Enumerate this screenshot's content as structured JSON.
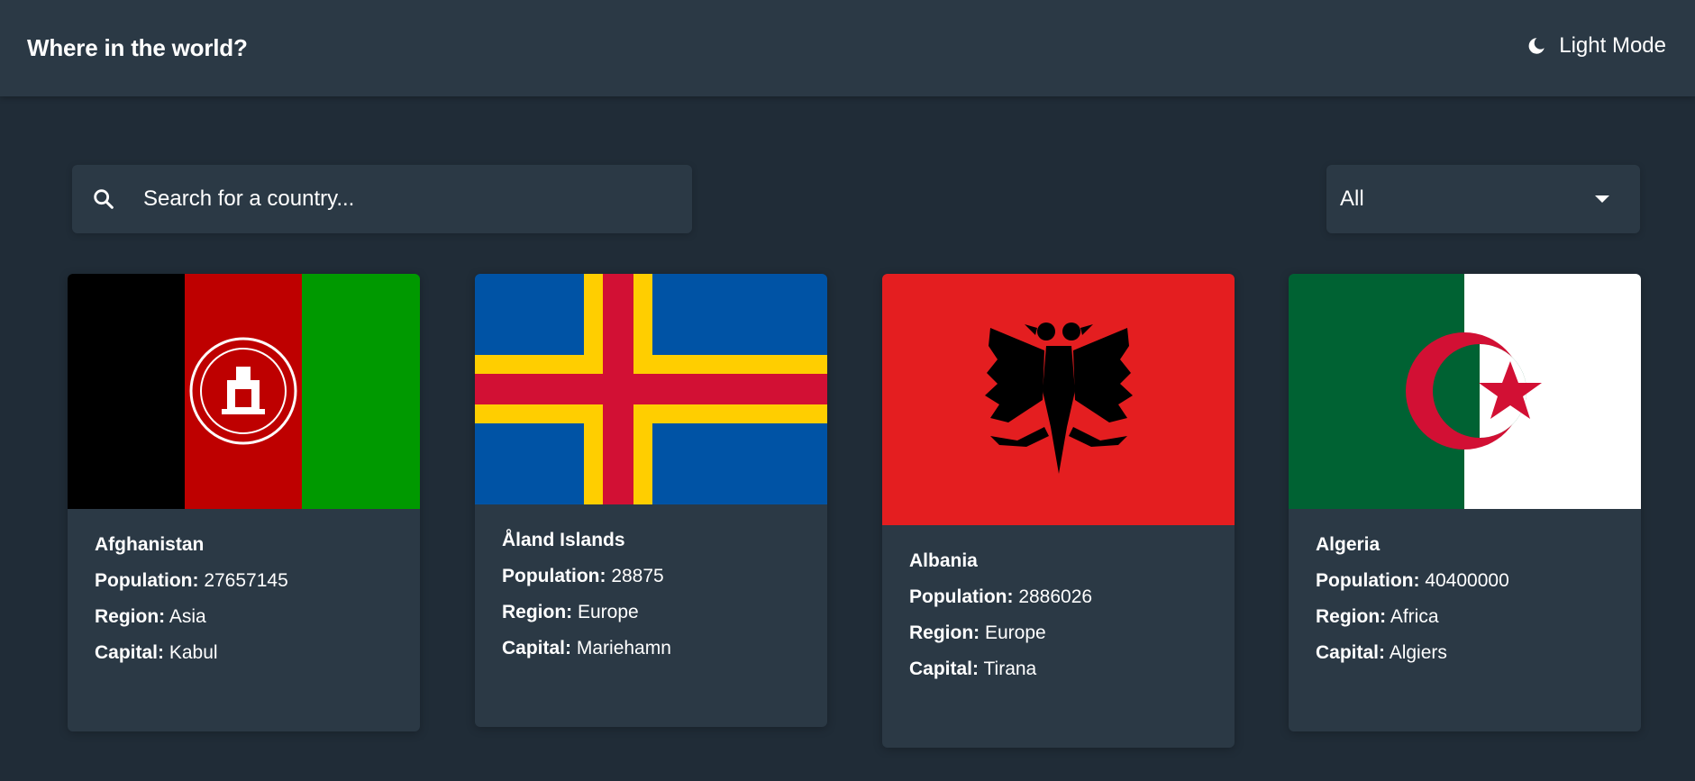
{
  "header": {
    "title": "Where in the world?",
    "mode_toggle_label": "Light Mode",
    "mode_icon": "moon-icon"
  },
  "search": {
    "placeholder": "Search for a country...",
    "icon": "search-icon"
  },
  "filter": {
    "selected": "All",
    "icon": "caret-down-icon"
  },
  "labels": {
    "population": "Population:",
    "region": "Region:",
    "capital": "Capital:"
  },
  "countries": [
    {
      "name": "Afghanistan",
      "population": "27657145",
      "region": "Asia",
      "capital": "Kabul",
      "flag": "afghanistan-flag"
    },
    {
      "name": "Åland Islands",
      "population": "28875",
      "region": "Europe",
      "capital": "Mariehamn",
      "flag": "aland-islands-flag"
    },
    {
      "name": "Albania",
      "population": "2886026",
      "region": "Europe",
      "capital": "Tirana",
      "flag": "albania-flag"
    },
    {
      "name": "Algeria",
      "population": "40400000",
      "region": "Africa",
      "capital": "Algiers",
      "flag": "algeria-flag"
    }
  ],
  "colors": {
    "background": "#202c37",
    "element": "#2b3945",
    "text": "#ffffff"
  }
}
